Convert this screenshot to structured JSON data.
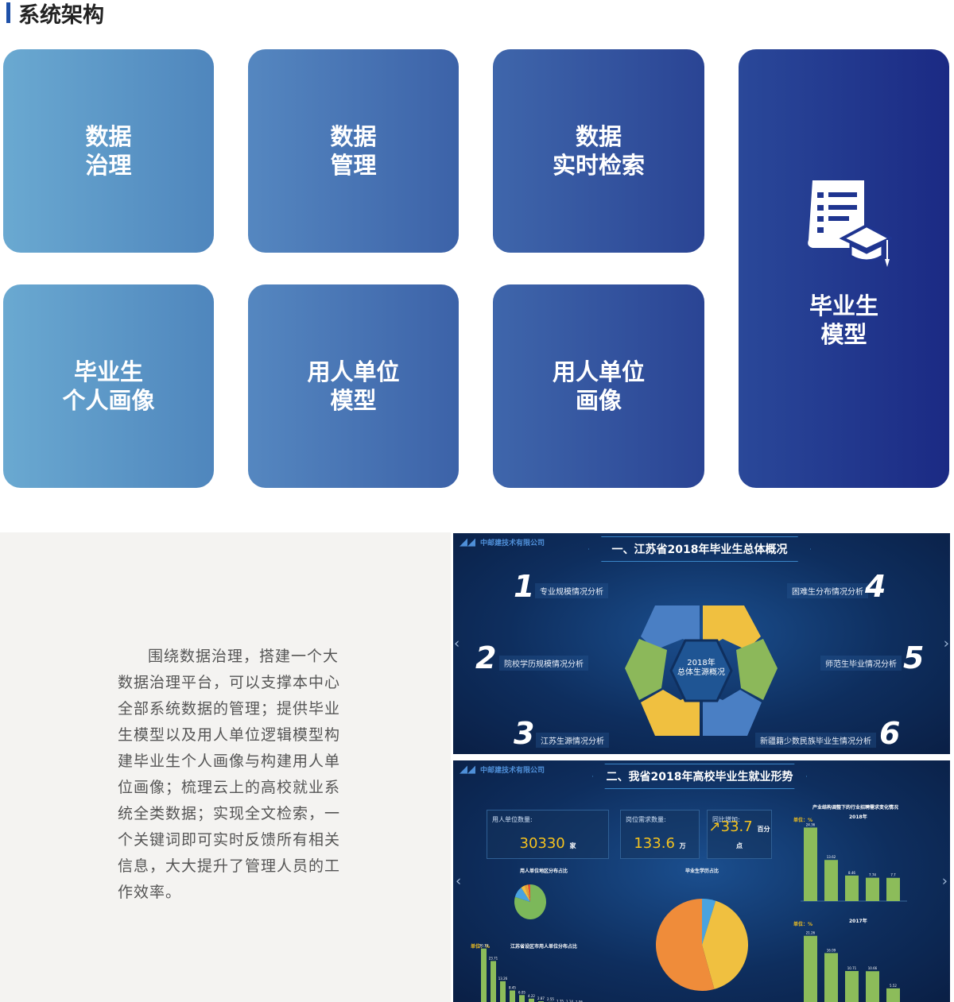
{
  "section_title": "系统架构",
  "cards": [
    {
      "lines": [
        "数据",
        "治理"
      ]
    },
    {
      "lines": [
        "数据",
        "管理"
      ]
    },
    {
      "lines": [
        "数据",
        "实时检索"
      ]
    },
    {
      "lines": [
        "毕业生",
        "个人画像"
      ]
    },
    {
      "lines": [
        "用人单位",
        "模型"
      ]
    },
    {
      "lines": [
        "用人单位",
        "画像"
      ]
    },
    {
      "lines": [
        "毕业生",
        "模型"
      ],
      "icon": "document-graduation-cap-icon"
    }
  ],
  "description": "围绕数据治理，搭建一个大数据治理平台，可以支撑本中心全部系统数据的管理；提供毕业生模型以及用人单位逻辑模型构建毕业生个人画像与构建用人单位画像；梳理云上的高校就业系统全类数据；实现全文检索，一个关键词即可实时反馈所有相关信息，大大提升了管理人员的工作效率。",
  "screenshot1": {
    "company": "中邮建技术有限公司",
    "title": "一、江苏省2018年毕业生总体概况",
    "center": [
      "2018年",
      "总体生源概况"
    ],
    "items": [
      {
        "num": "1",
        "label": "专业规模情况分析"
      },
      {
        "num": "2",
        "label": "院校学历规模情况分析"
      },
      {
        "num": "3",
        "label": "江苏生源情况分析"
      },
      {
        "num": "4",
        "label": "困难生分布情况分析"
      },
      {
        "num": "5",
        "label": "师范生毕业情况分析"
      },
      {
        "num": "6",
        "label": "新疆籍少数民族毕业生情况分析"
      }
    ],
    "colors": {
      "blue": "#4a7fc4",
      "yellow": "#f0c040",
      "green": "#8cb85a"
    }
  },
  "screenshot2": {
    "company": "中邮建技术有限公司",
    "title": "二、我省2018年高校毕业生就业形势",
    "kpis": [
      {
        "label": "用人单位数量:",
        "value": "30330",
        "unit": "家"
      },
      {
        "label": "岗位需求数量:",
        "value": "133.6",
        "unit": "万"
      },
      {
        "label": "同比增加:",
        "value": "33.7",
        "unit": "百分点",
        "icon": "trend-up-icon"
      }
    ],
    "region_pie_title": "用人单位地区分布占比",
    "edu_pie_title": "毕业生学历占比",
    "city_bar_title": "江苏省设区市用人单位分布占比",
    "industry_title": "产业结构调整下的行业招聘需求变化情况",
    "unit": "单位：%",
    "chart_data": [
      {
        "type": "bar",
        "title": "2018年",
        "ylim": [
          0,
          25
        ],
        "values": [
          24.36,
          13.62,
          8.46,
          7.74,
          7.7
        ]
      },
      {
        "type": "bar",
        "title": "2017年",
        "ylim": [
          0,
          25
        ],
        "values": [
          21.26,
          16.09,
          10.71,
          10.66,
          5.52
        ]
      },
      {
        "type": "bar",
        "title": "江苏省设区市用人单位分布占比",
        "ylim": [
          0,
          35
        ],
        "values": [
          30.19,
          23.71,
          13.26,
          8.45,
          6.05,
          4.22,
          2.87,
          2.55,
          1.35,
          1.14,
          1.06
        ]
      },
      {
        "type": "pie",
        "title": "毕业生学历占比",
        "values": [
          4.8,
          40.9,
          54.3
        ],
        "colors": [
          "#4aa3df",
          "#f0c040",
          "#ef8c3a"
        ]
      },
      {
        "type": "pie",
        "title": "用人单位地区分布占比",
        "values": [
          79.6,
          10.7,
          4.0,
          1.7,
          1.7,
          2.3
        ],
        "colors": [
          "#7cb85a",
          "#4aa3df",
          "#f0c040",
          "#f59a3a",
          "#f4b030",
          "#e8503a"
        ]
      }
    ]
  }
}
